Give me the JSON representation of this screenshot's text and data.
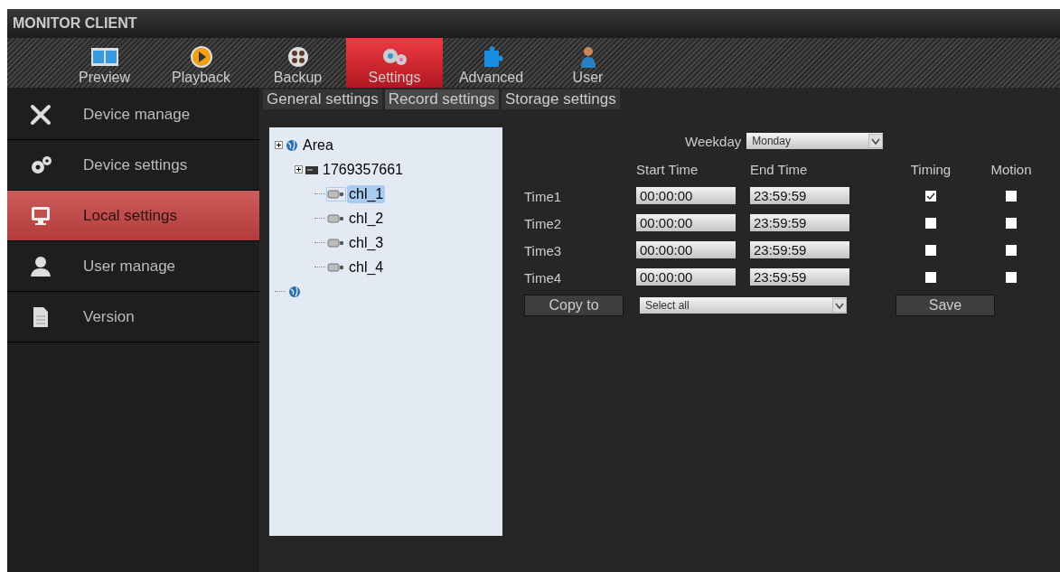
{
  "window": {
    "title": "MONITOR CLIENT"
  },
  "toolbar": [
    {
      "label": "Preview",
      "selected": false
    },
    {
      "label": "Playback",
      "selected": false
    },
    {
      "label": "Backup",
      "selected": false
    },
    {
      "label": "Settings",
      "selected": true
    },
    {
      "label": "Advanced",
      "selected": false
    },
    {
      "label": "User",
      "selected": false
    }
  ],
  "sidebar": {
    "items": [
      {
        "label": "Device manage",
        "selected": false
      },
      {
        "label": "Device settings",
        "selected": false
      },
      {
        "label": "Local settings",
        "selected": true
      },
      {
        "label": "User manage",
        "selected": false
      },
      {
        "label": "Version",
        "selected": false
      }
    ]
  },
  "tabs": [
    {
      "label": "General settings",
      "selected": false
    },
    {
      "label": "Record settings",
      "selected": true
    },
    {
      "label": "Storage settings",
      "selected": false
    }
  ],
  "tree": [
    {
      "kind": "area",
      "label": "Area",
      "selected": false,
      "children": [
        {
          "kind": "device",
          "label": "1769357661",
          "selected": false,
          "children": [
            {
              "kind": "channel",
              "label": "chl_1",
              "selected": true
            },
            {
              "kind": "channel",
              "label": "chl_2",
              "selected": false
            },
            {
              "kind": "channel",
              "label": "chl_3",
              "selected": false
            },
            {
              "kind": "channel",
              "label": "chl_4",
              "selected": false
            }
          ]
        }
      ]
    },
    {
      "kind": "area",
      "selected": false
    }
  ],
  "schedule": {
    "weekday_label": "Weekday",
    "weekday": "Monday",
    "columns": [
      "Start Time",
      "End Time",
      "Timing",
      "Motion"
    ],
    "rows": [
      {
        "label": "Time1",
        "start": "00:00:00",
        "end": "23:59:59",
        "timing": true,
        "motion": false
      },
      {
        "label": "Time2",
        "start": "00:00:00",
        "end": "23:59:59",
        "timing": false,
        "motion": false
      },
      {
        "label": "Time3",
        "start": "00:00:00",
        "end": "23:59:59",
        "timing": false,
        "motion": false
      },
      {
        "label": "Time4",
        "start": "00:00:00",
        "end": "23:59:59",
        "timing": false,
        "motion": false
      }
    ],
    "copy_button": "Copy to",
    "copy_target": "Select all",
    "save_button": "Save"
  }
}
